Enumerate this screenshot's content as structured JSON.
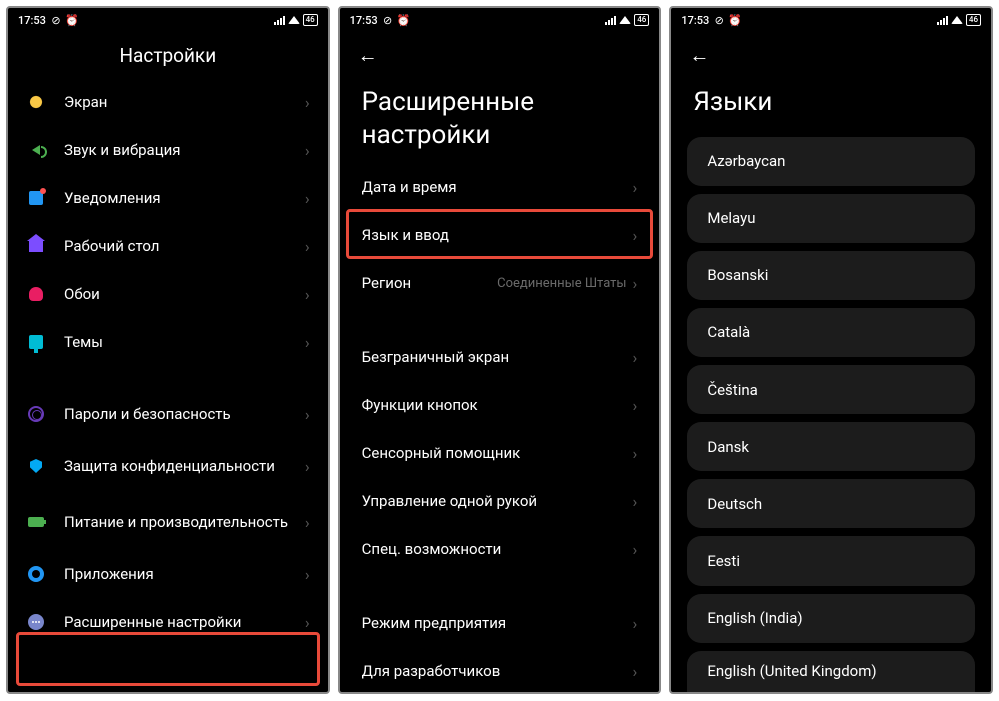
{
  "status": {
    "time": "17:53",
    "battery": "46"
  },
  "screen1": {
    "title": "Настройки",
    "items": [
      {
        "label": "Экран"
      },
      {
        "label": "Звук и вибрация"
      },
      {
        "label": "Уведомления"
      },
      {
        "label": "Рабочий стол"
      },
      {
        "label": "Обои"
      },
      {
        "label": "Темы"
      },
      {
        "label": "Пароли и безопасность"
      },
      {
        "label": "Защита конфиденциальности"
      },
      {
        "label": "Питание и производительность"
      },
      {
        "label": "Приложения"
      },
      {
        "label": "Расширенные настройки"
      }
    ]
  },
  "screen2": {
    "title": "Расширенные настройки",
    "items": [
      {
        "label": "Дата и время"
      },
      {
        "label": "Язык и ввод"
      },
      {
        "label": "Регион",
        "value": "Соединенные Штаты"
      },
      {
        "label": "Безграничный экран"
      },
      {
        "label": "Функции кнопок"
      },
      {
        "label": "Сенсорный помощник"
      },
      {
        "label": "Управление одной рукой"
      },
      {
        "label": "Спец. возможности"
      },
      {
        "label": "Режим предприятия"
      },
      {
        "label": "Для разработчиков"
      }
    ]
  },
  "screen3": {
    "title": "Языки",
    "languages": [
      "Azərbaycan",
      "Melayu",
      "Bosanski",
      "Català",
      "Čeština",
      "Dansk",
      "Deutsch",
      "Eesti",
      "English (India)",
      "English (United Kingdom)"
    ]
  }
}
